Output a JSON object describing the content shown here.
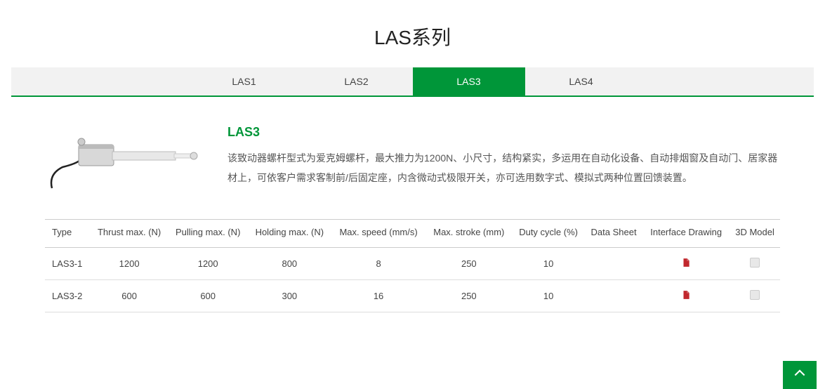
{
  "page": {
    "title": "LAS系列"
  },
  "tabs": [
    {
      "label": "LAS1",
      "active": false
    },
    {
      "label": "LAS2",
      "active": false
    },
    {
      "label": "LAS3",
      "active": true
    },
    {
      "label": "LAS4",
      "active": false
    }
  ],
  "product": {
    "heading": "LAS3",
    "description": "该致动器螺杆型式为爱克姆螺杆，最大推力为1200N、小尺寸，结构紧实，多运用在自动化设备、自动排烟窗及自动门、居家器材上，可依客户需求客制前/后固定座，内含微动式极限开关，亦可选用数字式、模拟式两种位置回馈装置。"
  },
  "table": {
    "headers": [
      "Type",
      "Thrust max. (N)",
      "Pulling max. (N)",
      "Holding max. (N)",
      "Max. speed (mm/s)",
      "Max. stroke (mm)",
      "Duty cycle (%)",
      "Data Sheet",
      "Interface Drawing",
      "3D Model"
    ],
    "rows": [
      {
        "type": "LAS3-1",
        "thrust": "1200",
        "pulling": "1200",
        "holding": "800",
        "speed": "8",
        "stroke": "250",
        "duty": "10",
        "datasheet": "",
        "drawing": "pdf",
        "model": "file"
      },
      {
        "type": "LAS3-2",
        "thrust": "600",
        "pulling": "600",
        "holding": "300",
        "speed": "16",
        "stroke": "250",
        "duty": "10",
        "datasheet": "",
        "drawing": "pdf",
        "model": "file"
      }
    ]
  }
}
